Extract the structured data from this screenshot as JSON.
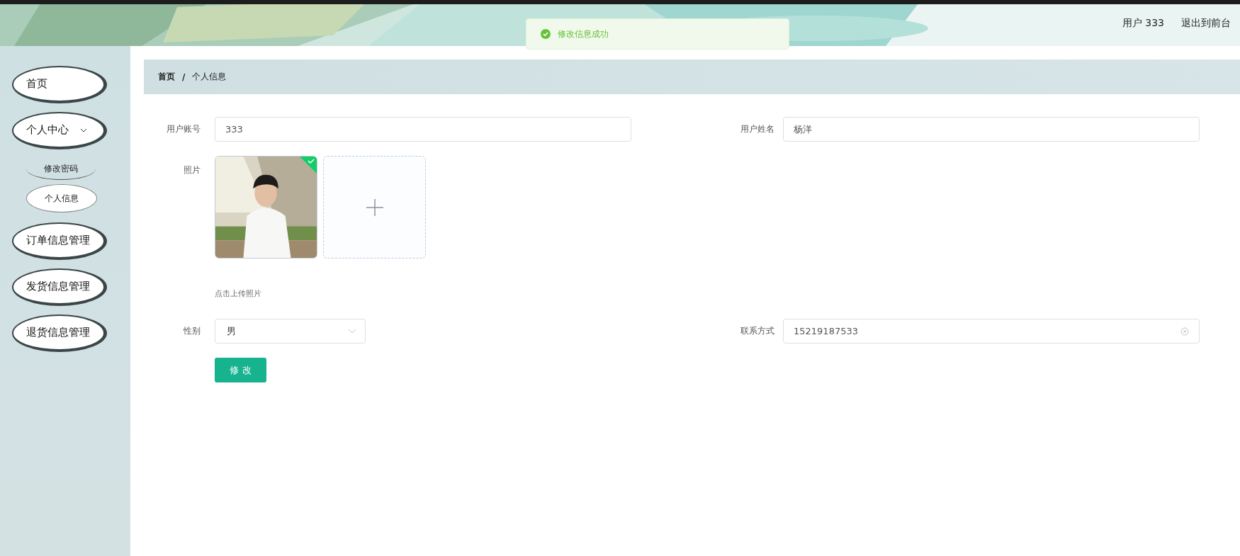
{
  "header": {
    "user_label": "用户 333",
    "exit_link": "退出到前台"
  },
  "toast": {
    "kind": "success",
    "message": "修改信息成功"
  },
  "sidebar": {
    "items": [
      {
        "label": "首页"
      },
      {
        "label": "个人中心",
        "expanded": true,
        "children": [
          {
            "label": "修改密码",
            "selected": false
          },
          {
            "label": "个人信息",
            "selected": true
          }
        ]
      },
      {
        "label": "订单信息管理"
      },
      {
        "label": "发货信息管理"
      },
      {
        "label": "退货信息管理"
      }
    ]
  },
  "breadcrumb": [
    "首页",
    "个人信息"
  ],
  "breadcrumb_separator": "/",
  "form": {
    "account_label": "用户账号",
    "account_value": "333",
    "name_label": "用户姓名",
    "name_value": "杨洋",
    "photo_label": "照片",
    "photo": {
      "kind": "picture",
      "uploaded": true
    },
    "upload_hint": "点击上传照片",
    "gender_label": "性别",
    "gender_value": "男",
    "contact_label": "联系方式",
    "contact_value": "15219187533",
    "submit": "修 改"
  }
}
